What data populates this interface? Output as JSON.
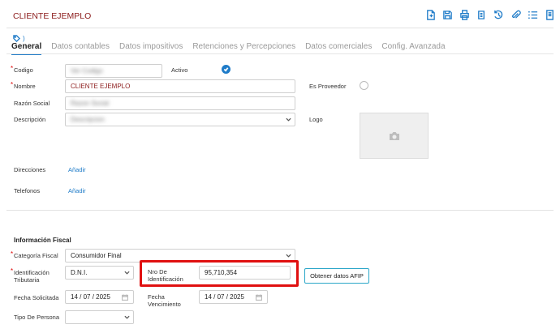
{
  "header": {
    "title": "CLIENTE EJEMPLO",
    "toolbar": [
      "new-document-icon",
      "save-icon",
      "print-icon",
      "copy-icon",
      "history-icon",
      "attach-icon",
      "list-icon",
      "bookmark-icon"
    ]
  },
  "tag_label": ")",
  "tabs": [
    "General",
    "Datos contables",
    "Datos impositivos",
    "Retenciones y Percepciones",
    "Datos comerciales",
    "Config. Avanzada"
  ],
  "form": {
    "codigo_label": "Codigo",
    "codigo_value": "Ver Codigo",
    "activo_label": "Activo",
    "nombre_label": "Nombre",
    "nombre_value": "CLIENTE EJEMPLO",
    "proveedor_label": "Es Proveedor",
    "razon_label": "Razón Social",
    "razon_value": "Razon Social",
    "descripcion_label": "Descripción",
    "descripcion_value": "Descripcion",
    "logo_label": "Logo",
    "direcciones_label": "Direcciones",
    "direcciones_link": "Añadir",
    "telefonos_label": "Telefonos",
    "telefonos_link": "Añadir"
  },
  "fiscal": {
    "section_title": "Información Fiscal",
    "categoria_label": "Categoría Fiscal",
    "categoria_value": "Consumidor Final",
    "identificacion_label": "Identificación Tributaria",
    "identificacion_value": "D.N.I.",
    "nro_label": "Nro De Identificación",
    "nro_value": "95,710,354",
    "afip_button": "Obtener datos AFIP",
    "fecha_solicitada_label": "Fecha Solicitada",
    "fecha_solicitada_value": "14 / 07 / 2025",
    "fecha_venc_label": "Fecha Vencimiento",
    "fecha_venc_value": "14 / 07 / 2025",
    "tipo_persona_label": "Tipo De Persona",
    "tipo_persona_value": ""
  },
  "colors": {
    "accent": "#1e7bc8",
    "title": "#8b1a1a",
    "highlight": "#e01010"
  }
}
